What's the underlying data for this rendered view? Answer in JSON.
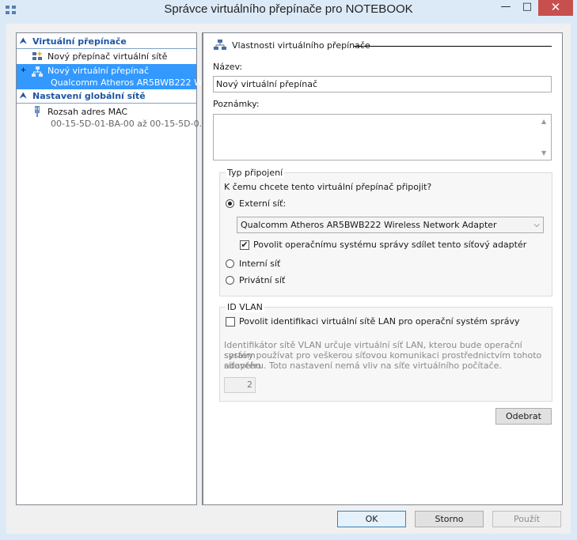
{
  "window": {
    "title": "Správce virtuálního přepínače pro NOTEBOOK",
    "minimize_glyph": "—",
    "maximize_glyph": "□",
    "close_glyph": "✕"
  },
  "left": {
    "section1": {
      "label": "Virtuální přepínače",
      "icon": "collapse-chevron-icon"
    },
    "new_switch": {
      "label": "Nový přepínač virtuální sítě",
      "icon": "new-switch-icon"
    },
    "selected_switch": {
      "label": "Nový virtuální přepínač",
      "adapter": "Qualcomm Atheros AR5BWB222 W...",
      "expander": "+"
    },
    "section2": {
      "label": "Nastavení globální sítě"
    },
    "mac_range": {
      "label": "Rozsah adres MAC",
      "value": "00-15-5D-01-BA-00 až 00-15-5D-0..."
    }
  },
  "right": {
    "header": "Vlastnosti virtuálního přepínače",
    "name_label": "Název:",
    "name_value": "Nový virtuální přepínač",
    "notes_label": "Poznámky:",
    "notes_value": "",
    "conn_group": {
      "title": "Typ připojení",
      "question": "K čemu chcete tento virtuální přepínač připojit?",
      "external": {
        "label": "Externí síť:",
        "selected": true
      },
      "adapter_select": "Qualcomm Atheros AR5BWB222 Wireless Network Adapter",
      "share_checkbox": {
        "label": "Povolit operačnímu systému správy sdílet tento síťový adaptér",
        "checked": true
      },
      "internal": {
        "label": "Interní síť",
        "selected": false
      },
      "private": {
        "label": "Privátní síť",
        "selected": false
      }
    },
    "vlan_group": {
      "title": "ID VLAN",
      "checkbox_label": "Povolit identifikaci virtuální sítě LAN pro operační systém správy",
      "checked": false,
      "desc1": "Identifikátor sítě VLAN určuje virtuální síť LAN, kterou bude operační systém",
      "desc2": "správy používat pro veškerou síťovou komunikaci prostřednictvím tohoto síťového",
      "desc3": "adaptéru. Toto nastavení nemá vliv na síťe virtuálního počítače.",
      "vlan_id": "2"
    },
    "remove_button": "Odebrat"
  },
  "footer": {
    "ok": "OK",
    "cancel": "Storno",
    "apply": "Použít"
  },
  "colors": {
    "section_header": "#1f55a5",
    "selection": "#3399ff",
    "close_button": "#c7504f",
    "titlebar": "#dceaf8"
  }
}
